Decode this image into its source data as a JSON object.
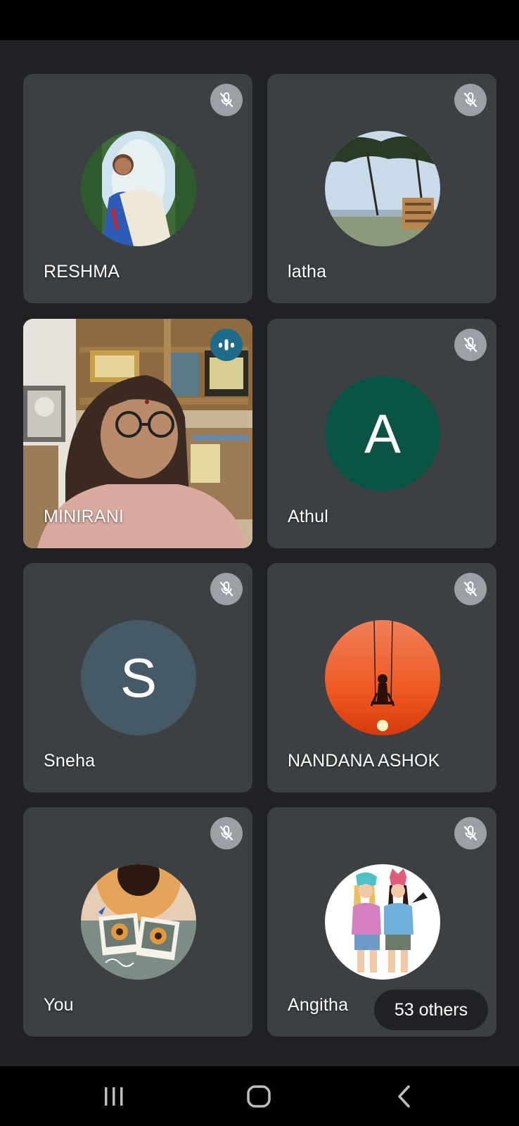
{
  "participants": [
    {
      "name": "RESHMA",
      "status": "muted",
      "avatar": "photo-woman-arch"
    },
    {
      "name": "latha",
      "status": "muted",
      "avatar": "photo-landscape-tree"
    },
    {
      "name": "MINIRANI",
      "status": "speaking",
      "avatar": "live-video"
    },
    {
      "name": "Athul",
      "status": "muted",
      "avatar_letter": "A",
      "avatar_color": "#0b5345"
    },
    {
      "name": "Sneha",
      "status": "muted",
      "avatar_letter": "S",
      "avatar_color": "#455a64"
    },
    {
      "name": "NANDANA ASHOK",
      "status": "muted",
      "avatar": "photo-sunset-swing"
    },
    {
      "name": "You",
      "status": "muted",
      "avatar": "photo-sunflowers"
    },
    {
      "name": "Angitha",
      "status": "muted",
      "avatar": "illustration-two-girls"
    }
  ],
  "others_chip": "53 others",
  "icons": {
    "muted": "mic-off-icon",
    "speaking": "audio-level-icon",
    "nav_recent": "recent-apps-icon",
    "nav_home": "home-icon",
    "nav_back": "back-icon"
  },
  "colors": {
    "background": "#202124",
    "tile": "#3c4043",
    "mute_badge": "#9aa0a6",
    "speaking_badge": "#1f6c8a"
  }
}
